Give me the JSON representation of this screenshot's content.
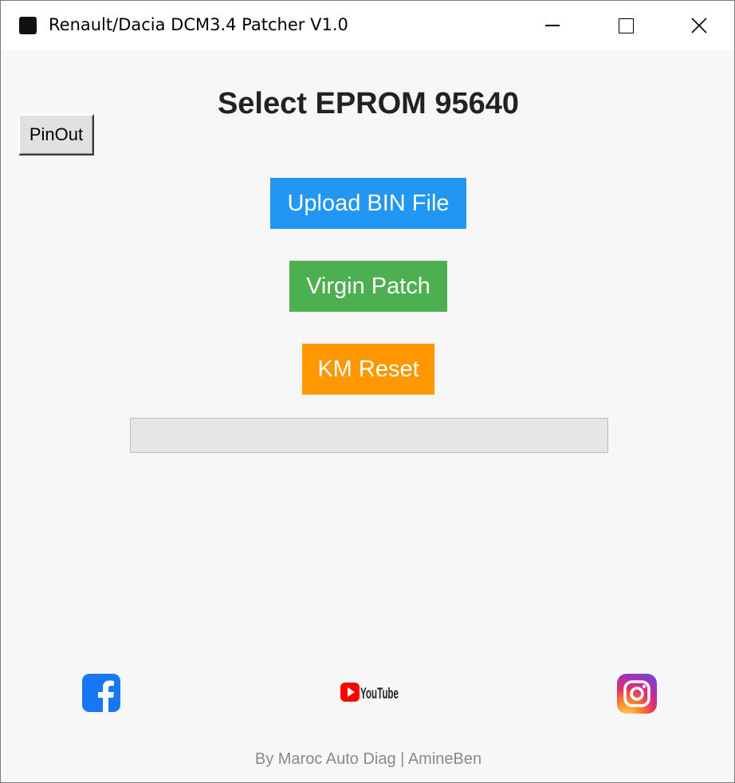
{
  "window": {
    "title": "Renault/Dacia DCM3.4 Patcher V1.0",
    "app_icon": "chip-icon"
  },
  "controls": {
    "minimize_icon": "minimize-icon",
    "maximize_icon": "maximize-icon",
    "close_icon": "close-icon"
  },
  "main": {
    "heading": "Select EPROM 95640",
    "pinout_label": "PinOut",
    "upload_label": "Upload BIN File",
    "virgin_label": "Virgin Patch",
    "km_label": "KM Reset",
    "progress_value": 0
  },
  "social": {
    "facebook_icon": "facebook-icon",
    "youtube_icon": "youtube-icon",
    "youtube_text": "YouTube",
    "instagram_icon": "instagram-icon"
  },
  "footer": {
    "credit": "By Maroc Auto Diag | AmineBen"
  },
  "colors": {
    "upload": "#2196f3",
    "virgin": "#4caf50",
    "km_reset": "#ff9800",
    "facebook": "#1877f2",
    "youtube": "#ff0000"
  }
}
